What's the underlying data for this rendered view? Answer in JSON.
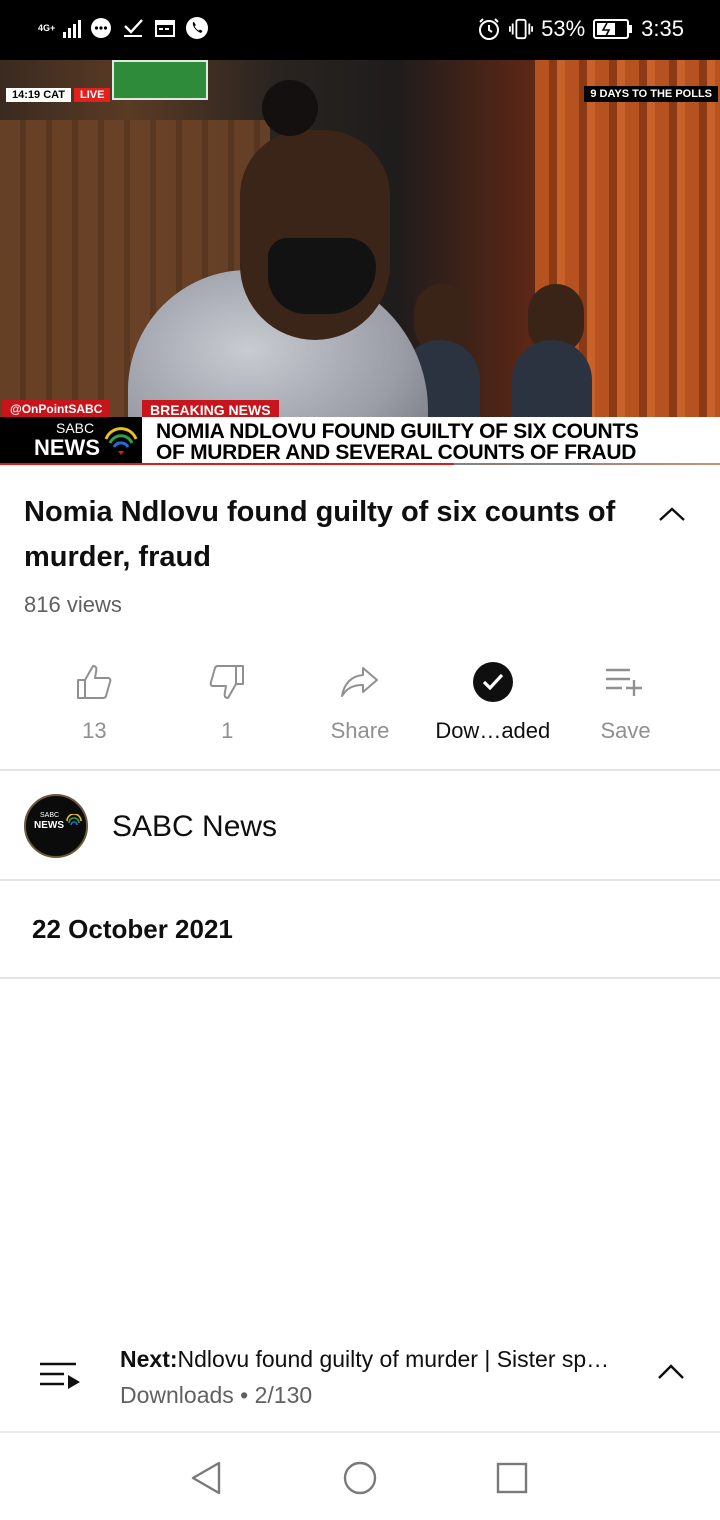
{
  "status_bar": {
    "network": "4G+",
    "battery": "53%",
    "time": "3:35",
    "icons": [
      "signal-icon",
      "messages-icon",
      "download-done-icon",
      "calendar-icon",
      "phone-icon",
      "alarm-icon",
      "vibrate-icon",
      "battery-charging-icon"
    ]
  },
  "video": {
    "time_chip": "14:19 CAT",
    "live_chip": "LIVE",
    "polls_chip": "9 DAYS TO THE POLLS",
    "handle_chip": "@OnPointSABC",
    "breaking_chip": "BREAKING NEWS",
    "logo_top": "SABC",
    "logo_bottom": "NEWS",
    "ticker_line1": "NOMIA NDLOVU FOUND GUILTY OF SIX COUNTS",
    "ticker_line2": "OF MURDER AND SEVERAL COUNTS OF FRAUD",
    "progress": 0.63,
    "accent_color": "#e01a1a"
  },
  "details": {
    "title": "Nomia Ndlovu found guilty of six counts of murder, fraud",
    "views": "816 views"
  },
  "actions": [
    {
      "name": "like",
      "label": "13",
      "icon": "thumbs-up-icon"
    },
    {
      "name": "dislike",
      "label": "1",
      "icon": "thumbs-down-icon"
    },
    {
      "name": "share",
      "label": "Share",
      "icon": "share-icon"
    },
    {
      "name": "download",
      "label": "Dow…aded",
      "icon": "check-circle-icon"
    },
    {
      "name": "save",
      "label": "Save",
      "icon": "playlist-add-icon"
    }
  ],
  "channel": {
    "name": "SABC News",
    "avatar_top": "SABC",
    "avatar_bottom": "NEWS"
  },
  "date": "22 October 2021",
  "next": {
    "prefix": "Next:",
    "title": "Ndlovu found guilty of murder | Sister sp…",
    "subtitle": "Downloads • 2/130"
  }
}
